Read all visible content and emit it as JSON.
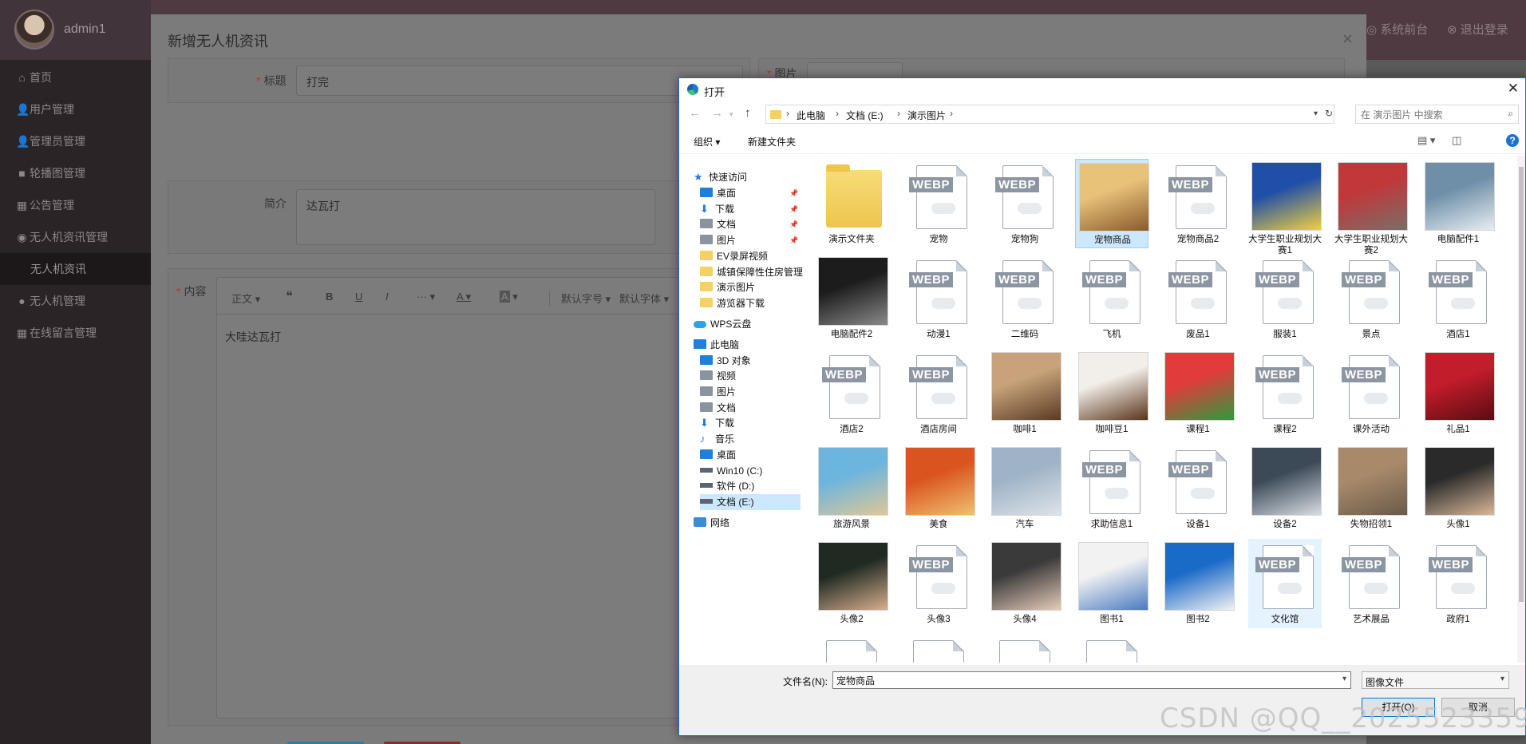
{
  "admin": {
    "username": "admin1",
    "top_links": [
      "系统前台",
      "退出登录"
    ],
    "menu": [
      {
        "label": "首页",
        "icon": "home-icon",
        "glyph": "⌂"
      },
      {
        "label": "用户管理",
        "icon": "user-icon",
        "glyph": "👤"
      },
      {
        "label": "管理员管理",
        "icon": "user-icon",
        "glyph": "👤"
      },
      {
        "label": "轮播图管理",
        "icon": "camera-icon",
        "glyph": "■"
      },
      {
        "label": "公告管理",
        "icon": "notice-icon",
        "glyph": "▦"
      },
      {
        "label": "无人机资讯管理",
        "icon": "globe-icon",
        "glyph": "◉"
      },
      {
        "label": "无人机资讯",
        "icon": "",
        "glyph": ""
      },
      {
        "label": "无人机管理",
        "icon": "drop-icon",
        "glyph": "●"
      },
      {
        "label": "在线留言管理",
        "icon": "table-icon",
        "glyph": "▦"
      }
    ]
  },
  "modal": {
    "title": "新增无人机资讯",
    "close": "×",
    "fields": {
      "title_label": "标题",
      "title_value": "打完",
      "image_label": "图片",
      "summary_label": "简介",
      "summary_value": "达瓦打",
      "content_label": "内容",
      "content_value": "大哇达瓦打"
    },
    "editor_toolbar": [
      "正文",
      "❝",
      "B",
      "U",
      "I",
      "···",
      "A",
      "A",
      "默认字号",
      "默认字体"
    ]
  },
  "dialog": {
    "title": "打开",
    "close": "✕",
    "nav": {
      "back": "←",
      "forward": "→",
      "up": "↑",
      "refresh": "↻"
    },
    "breadcrumb": [
      "此电脑",
      "文档 (E:)",
      "演示图片"
    ],
    "search_placeholder": "在 演示图片 中搜索",
    "commands": {
      "organize": "组织 ▾",
      "new_folder": "新建文件夹"
    },
    "tree": [
      {
        "label": "快速访问",
        "icon": "star",
        "indent": 0,
        "pinned": false
      },
      {
        "label": "桌面",
        "icon": "blue",
        "indent": 1,
        "pinned": true
      },
      {
        "label": "下载",
        "icon": "download",
        "indent": 1,
        "pinned": true
      },
      {
        "label": "文档",
        "icon": "gray",
        "indent": 1,
        "pinned": true
      },
      {
        "label": "图片",
        "icon": "gray",
        "indent": 1,
        "pinned": true
      },
      {
        "label": "EV录屏视频",
        "icon": "folder",
        "indent": 1,
        "pinned": false
      },
      {
        "label": "城镇保障性住房管理",
        "icon": "folder",
        "indent": 1,
        "pinned": false
      },
      {
        "label": "演示图片",
        "icon": "folder",
        "indent": 1,
        "pinned": false
      },
      {
        "label": "游览器下载",
        "icon": "folder",
        "indent": 1,
        "pinned": false
      },
      {
        "label": "WPS云盘",
        "icon": "cloud",
        "indent": 0,
        "pinned": false
      },
      {
        "label": "此电脑",
        "icon": "blue",
        "indent": 0,
        "pinned": false
      },
      {
        "label": "3D 对象",
        "icon": "blue",
        "indent": 1,
        "pinned": false
      },
      {
        "label": "视频",
        "icon": "gray",
        "indent": 1,
        "pinned": false
      },
      {
        "label": "图片",
        "icon": "gray",
        "indent": 1,
        "pinned": false
      },
      {
        "label": "文档",
        "icon": "gray",
        "indent": 1,
        "pinned": false
      },
      {
        "label": "下载",
        "icon": "download",
        "indent": 1,
        "pinned": false
      },
      {
        "label": "音乐",
        "icon": "music",
        "indent": 1,
        "pinned": false
      },
      {
        "label": "桌面",
        "icon": "blue",
        "indent": 1,
        "pinned": false
      },
      {
        "label": "Win10 (C:)",
        "icon": "drive",
        "indent": 1,
        "pinned": false
      },
      {
        "label": "软件 (D:)",
        "icon": "drive",
        "indent": 1,
        "pinned": false
      },
      {
        "label": "文档 (E:)",
        "icon": "drive",
        "indent": 1,
        "pinned": false,
        "selected": true
      },
      {
        "label": "网络",
        "icon": "net",
        "indent": 0,
        "pinned": false
      }
    ],
    "files": [
      {
        "name": "演示文件夹",
        "kind": "folder"
      },
      {
        "name": "宠物",
        "kind": "webp"
      },
      {
        "name": "宠物狗",
        "kind": "webp"
      },
      {
        "name": "宠物商品",
        "kind": "photo",
        "colors": [
          "#e9c27a",
          "#8a5a2b"
        ],
        "selected": true
      },
      {
        "name": "宠物商品2",
        "kind": "webp"
      },
      {
        "name": "大学生职业规划大赛1",
        "kind": "photo",
        "colors": [
          "#1f4fa8",
          "#f0d040"
        ]
      },
      {
        "name": "大学生职业规划大赛2",
        "kind": "photo",
        "colors": [
          "#c0383a",
          "#7a6e68"
        ]
      },
      {
        "name": "电脑配件1",
        "kind": "photo",
        "colors": [
          "#6f8fa8",
          "#e8eef2"
        ]
      },
      {
        "name": "电脑配件2",
        "kind": "photo",
        "colors": [
          "#1c1c1c",
          "#8a8a8a"
        ]
      },
      {
        "name": "动漫1",
        "kind": "webp"
      },
      {
        "name": "二维码",
        "kind": "webp"
      },
      {
        "name": "飞机",
        "kind": "webp"
      },
      {
        "name": "废品1",
        "kind": "webp"
      },
      {
        "name": "服装1",
        "kind": "webp"
      },
      {
        "name": "景点",
        "kind": "webp"
      },
      {
        "name": "酒店1",
        "kind": "webp"
      },
      {
        "name": "酒店2",
        "kind": "webp"
      },
      {
        "name": "酒店房间",
        "kind": "webp"
      },
      {
        "name": "咖啡1",
        "kind": "photo",
        "colors": [
          "#c7a27a",
          "#5a3a22"
        ]
      },
      {
        "name": "咖啡豆1",
        "kind": "photo",
        "colors": [
          "#f2efea",
          "#5a3418"
        ]
      },
      {
        "name": "课程1",
        "kind": "photo",
        "colors": [
          "#e23b3b",
          "#2f9a3f"
        ]
      },
      {
        "name": "课程2",
        "kind": "webp"
      },
      {
        "name": "课外活动",
        "kind": "webp"
      },
      {
        "name": "礼品1",
        "kind": "photo",
        "colors": [
          "#c21d2a",
          "#5a0c12"
        ]
      },
      {
        "name": "旅游风景",
        "kind": "photo",
        "colors": [
          "#6bb5de",
          "#e0c796"
        ]
      },
      {
        "name": "美食",
        "kind": "photo",
        "colors": [
          "#d9541e",
          "#f0c070"
        ]
      },
      {
        "name": "汽车",
        "kind": "photo",
        "colors": [
          "#9fb3c7",
          "#dde3e8"
        ]
      },
      {
        "name": "求助信息1",
        "kind": "webp"
      },
      {
        "name": "设备1",
        "kind": "webp"
      },
      {
        "name": "设备2",
        "kind": "photo",
        "colors": [
          "#3c4a58",
          "#d8dde2"
        ]
      },
      {
        "name": "失物招领1",
        "kind": "photo",
        "colors": [
          "#a88a6a",
          "#6a5a4a"
        ]
      },
      {
        "name": "头像1",
        "kind": "photo",
        "colors": [
          "#2a2a2a",
          "#d9b89a"
        ]
      },
      {
        "name": "头像2",
        "kind": "photo",
        "colors": [
          "#1f2a22",
          "#d8ae8e"
        ]
      },
      {
        "name": "头像3",
        "kind": "webp"
      },
      {
        "name": "头像4",
        "kind": "photo",
        "colors": [
          "#3a3a3a",
          "#e6cbb8"
        ]
      },
      {
        "name": "图书1",
        "kind": "photo",
        "colors": [
          "#f2f2f2",
          "#4a7ac0"
        ]
      },
      {
        "name": "图书2",
        "kind": "photo",
        "colors": [
          "#1a6ac8",
          "#f2f2f2"
        ]
      },
      {
        "name": "文化馆",
        "kind": "webp",
        "hover": true
      },
      {
        "name": "艺术展品",
        "kind": "webp"
      },
      {
        "name": "政府1",
        "kind": "webp"
      }
    ],
    "filename_label": "文件名(N):",
    "filename_value": "宠物商品",
    "filetype_value": "图像文件",
    "open_button": "打开(O)",
    "cancel_button": "取消"
  },
  "watermark": "CSDN @QQ__2025523359",
  "colors": {
    "dialog_accent": "#0078d7",
    "selection": "#cce8ff",
    "folder": "#f4d162"
  }
}
